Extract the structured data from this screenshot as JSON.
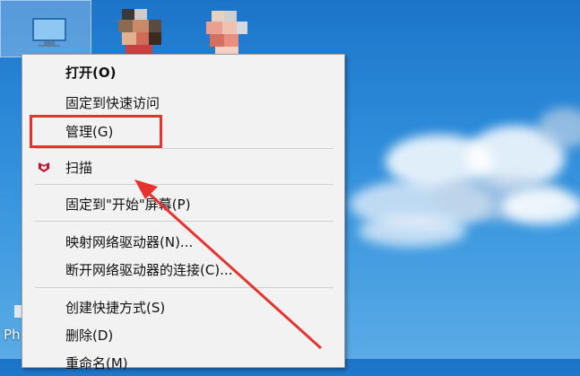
{
  "desktop": {
    "icons": [
      "this-pc-icon",
      "network-icon",
      "recycle-bin-icon"
    ],
    "side_label": "Ph"
  },
  "menu": {
    "items": [
      {
        "label": "打开(O)",
        "bold": true
      },
      {
        "label": "固定到快速访问"
      },
      {
        "label": "管理(G)"
      },
      {
        "label": "扫描",
        "icon": "mcafee-shield-icon"
      },
      {
        "label": "固定到\"开始\"屏幕(P)"
      },
      {
        "label": "映射网络驱动器(N)..."
      },
      {
        "label": "断开网络驱动器的连接(C)..."
      },
      {
        "label": "创建快捷方式(S)"
      },
      {
        "label": "删除(D)"
      },
      {
        "label": "重命名(M)"
      }
    ]
  },
  "annotation": {
    "color": "#e8322f",
    "target": "管理(G)"
  }
}
